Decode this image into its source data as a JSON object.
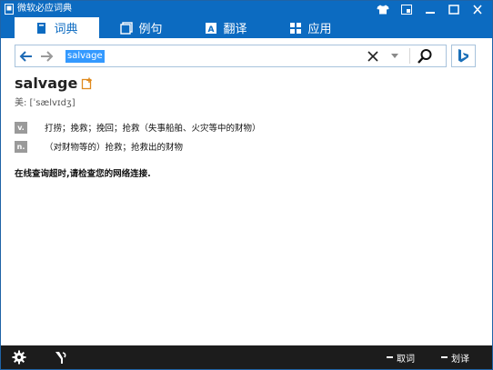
{
  "window": {
    "title": "微软必应词典"
  },
  "tabs": [
    {
      "label": "词典",
      "icon": "book-icon",
      "active": true
    },
    {
      "label": "例句",
      "icon": "notes-icon",
      "active": false
    },
    {
      "label": "翻译",
      "icon": "translate-icon",
      "active": false
    },
    {
      "label": "应用",
      "icon": "apps-icon",
      "active": false
    }
  ],
  "search": {
    "query": "salvage"
  },
  "word": {
    "headword": "salvage",
    "phonetic": "美: [ˈsælvɪdʒ]",
    "definitions": [
      {
        "pos": "v.",
        "text": "打捞；挽救；挽回；抢救（失事船舶、火灾等中的财物）"
      },
      {
        "pos": "n.",
        "text": "（对财物等的）抢救；抢救出的财物"
      }
    ]
  },
  "status": {
    "message": "在线查询超时,请检查您的网络连接."
  },
  "bottombar": {
    "cancel_label": "取词",
    "translate_label": "划译"
  },
  "colors": {
    "brand": "#0c6bc1",
    "selection": "#3399ff",
    "bottombar": "#1c1c1c",
    "pos_badge": "#9a9a9a"
  }
}
